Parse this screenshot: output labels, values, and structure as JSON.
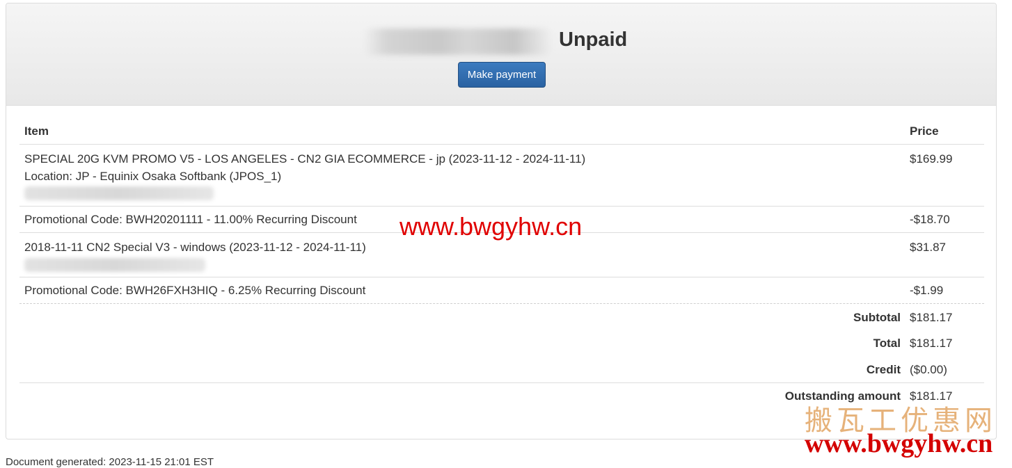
{
  "header": {
    "status": "Unpaid",
    "pay_button": "Make payment"
  },
  "table": {
    "col_item": "Item",
    "col_price": "Price",
    "rows": [
      {
        "item": "SPECIAL 20G KVM PROMO V5 - LOS ANGELES - CN2 GIA ECOMMERCE - jp (2023-11-12 - 2024-11-11)",
        "item_line2": "Location: JP - Equinix Osaka Softbank (JPOS_1)",
        "price": "$169.99"
      },
      {
        "item": "Promotional Code: BWH20201111 - 11.00% Recurring Discount",
        "price": "-$18.70"
      },
      {
        "item": "2018-11-11 CN2 Special V3 - windows (2023-11-12 - 2024-11-11)",
        "price": "$31.87"
      },
      {
        "item": "Promotional Code: BWH26FXH3HIQ - 6.25% Recurring Discount",
        "price": "-$1.99"
      }
    ]
  },
  "summary": {
    "subtotal_label": "Subtotal",
    "subtotal_value": "$181.17",
    "total_label": "Total",
    "total_value": "$181.17",
    "credit_label": "Credit",
    "credit_value": "($0.00)",
    "outstanding_label": "Outstanding amount",
    "outstanding_value": "$181.17"
  },
  "watermarks": {
    "center_url": "www.bwgyhw.cn",
    "corner_cn": "搬瓦工优惠网",
    "corner_url": "www.bwgyhw.cn"
  },
  "footer": {
    "text": "Document generated: 2023-11-15 21:01 EST"
  },
  "colors": {
    "button": "#2f6db0",
    "watermark_red": "#e00000",
    "watermark_gold": "#e6b27a"
  }
}
